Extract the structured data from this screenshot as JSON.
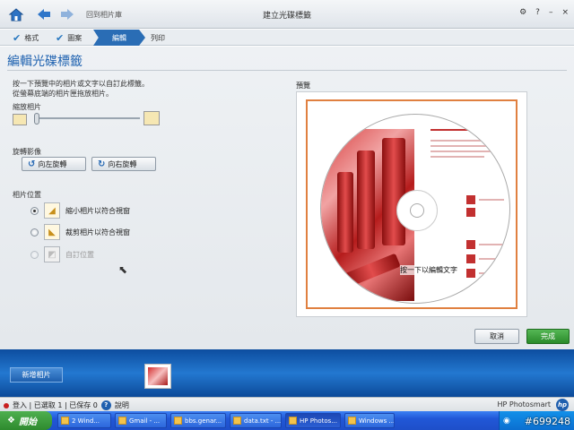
{
  "topbar": {
    "back_label": "回到相片庫",
    "title": "建立光碟標籤",
    "settings_icon": "⚙",
    "help_icon": "?",
    "minimize_icon": "–",
    "close_icon": "×"
  },
  "steps": [
    {
      "label": "格式",
      "done": true
    },
    {
      "label": "圖案",
      "done": true
    },
    {
      "label": "編輯",
      "active": true
    },
    {
      "label": "列印"
    }
  ],
  "main": {
    "page_title": "編輯光碟標籤",
    "instructions": [
      "按一下預覽中的相片或文字以自訂此標籤。",
      "從螢幕底端的相片匣拖放相片。"
    ],
    "zoom_label": "縮放相片",
    "rotate_label": "旋轉影像",
    "rotate_left": "向左旋轉",
    "rotate_right": "向右旋轉",
    "position_label": "相片位置",
    "position_options": [
      {
        "label": "縮小相片以符合視窗",
        "selected": true,
        "disabled": false
      },
      {
        "label": "裁剪相片以符合視窗",
        "selected": false,
        "disabled": false
      },
      {
        "label": "自訂位置",
        "selected": false,
        "disabled": true
      }
    ],
    "preview_label": "預覽",
    "disc_text": "按一下以編輯文字",
    "cancel": "取消",
    "finish": "完成"
  },
  "tray": {
    "add_photo": "新增相片"
  },
  "status": {
    "text": "登入 | 已選取 1 | 已保存 0",
    "help": "說明",
    "brand": "HP Photosmart"
  },
  "taskbar": {
    "start": "開始",
    "tasks": [
      "2 Wind...",
      "Gmail - ...",
      "bbs.genar...",
      "data.txt - ...",
      "HP Photos...",
      "Windows ..."
    ],
    "watermark": "#699248"
  },
  "colors": {
    "accent": "#2a6db5",
    "title_blue": "#1f62b0",
    "finish_green": "#2a8a2a",
    "preview_border": "#e08040"
  }
}
